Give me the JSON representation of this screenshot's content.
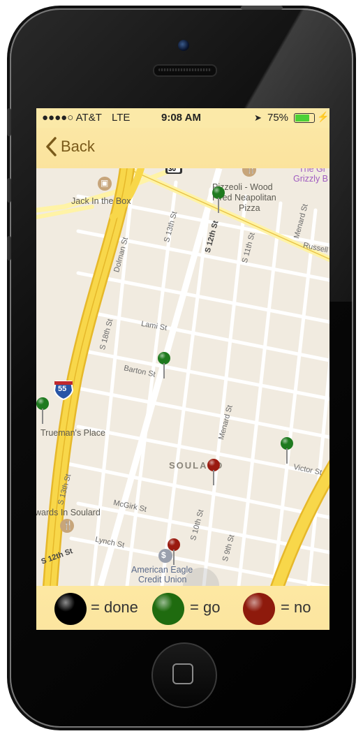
{
  "status_bar": {
    "carrier": "●●●●○ AT&T",
    "network": "LTE",
    "time": "9:08 AM",
    "battery": "75%",
    "battery_level": 0.75
  },
  "nav": {
    "back_label": "Back"
  },
  "map": {
    "streets": [
      "Jack In the Box",
      "Pizzeoli - Wood Fired Neapolitan Pizza",
      "The Grizzly B",
      "Russell",
      "S 13th St",
      "Dolman St",
      "S 12th St",
      "S 11th St",
      "Menard St",
      "S 18th St",
      "Lami St",
      "Barton St",
      "Trueman's Place",
      "SOULARD",
      "Victor St",
      "S 13th St",
      "McGirk St",
      "S 10th St",
      "S 9th St",
      "Lynch St",
      "S 12th St",
      "American Eagle Credit Union",
      "Edwards In Soulard"
    ],
    "highway_shield_top": "55",
    "highway_shield_bottom": "55",
    "route_shield": "30",
    "labels": {
      "jack": "Jack In the Box",
      "pizzeoli_1": "Pizzeoli - Wood",
      "pizzeoli_2": "Fired Neapolitan",
      "pizzeoli_3": "Pizza",
      "grizzly_1": "The Gr",
      "grizzly_2": "Grizzly B",
      "russell": "Russell",
      "s13_top": "S 13th St",
      "dolman": "Dolman St",
      "s12": "S 12th St",
      "s11": "S 11th St",
      "menard_top": "Menard St",
      "s18": "S 18th St",
      "lami": "Lami St",
      "barton": "Barton St",
      "trueman": "Trueman's Place",
      "soulard": "SOULARD",
      "menard_mid": "Menard St",
      "victor": "Victor St",
      "s13_bottom": "S 13th St",
      "mcgirk": "McGirk St",
      "s10": "S 10th St",
      "s9": "S 9th St",
      "lynch": "Lynch St",
      "s12_bottom": "S 12th St",
      "eagle_1": "American Eagle",
      "eagle_2": "Credit Union",
      "edwards": "wards In Soulard"
    },
    "pins": [
      {
        "status": "go",
        "color": "#1f7a1f"
      },
      {
        "status": "go",
        "color": "#1f7a1f"
      },
      {
        "status": "go",
        "color": "#1f7a1f"
      },
      {
        "status": "go",
        "color": "#1f7a1f"
      },
      {
        "status": "no",
        "color": "#9a1b10"
      },
      {
        "status": "no",
        "color": "#9a1b10"
      }
    ]
  },
  "legend": {
    "done_label": "= done",
    "go_label": "= go",
    "no_label": "= no",
    "done_color": "#000000",
    "go_color": "#1f6b0f",
    "no_color": "#8e1a0c"
  },
  "colors": {
    "bar_bg": "#fbe7a5",
    "highway": "#f6cf3c",
    "map_bg": "#f1ebe0",
    "street": "#ffffff",
    "arterial": "#fff3a6"
  }
}
